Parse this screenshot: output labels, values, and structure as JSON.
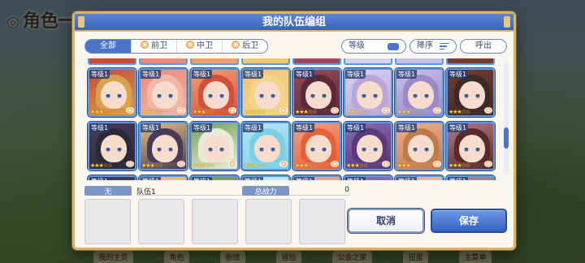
{
  "background": {
    "title": "角色一覧",
    "bottom_tabs": [
      "我的主页",
      "角色",
      "剧情",
      "冒险",
      "公会之家",
      "扭蛋",
      "主菜单"
    ]
  },
  "modal": {
    "title": "我的队伍编组",
    "filters": {
      "tabs": [
        {
          "label": "全部",
          "active": true
        },
        {
          "label": "前卫",
          "active": false
        },
        {
          "label": "中卫",
          "active": false
        },
        {
          "label": "后卫",
          "active": false
        }
      ],
      "level_label": "等级",
      "sort_label": "降序",
      "call_label": "呼出"
    },
    "characters": {
      "level_text": "等级1",
      "rows": [
        [
          {
            "hair": "#d8a14a",
            "bg": "#c44a3a",
            "stars": 3
          },
          {
            "hair": "#f1b6a8",
            "bg": "#e88b7a",
            "stars": 3
          },
          {
            "hair": "#d4503a",
            "bg": "#f0a070",
            "stars": 3
          },
          {
            "hair": "#f3d585",
            "bg": "#f5c37a",
            "stars": 3
          },
          {
            "hair": "#5a2a3a",
            "bg": "#9a4a5a",
            "stars": 3
          },
          {
            "hair": "#b9a6d8",
            "bg": "#d8d0f0",
            "stars": 3
          },
          {
            "hair": "#9a8ac8",
            "bg": "#c8c0e8",
            "stars": 3
          },
          {
            "hair": "#3a2a2a",
            "bg": "#7a3a2a",
            "stars": 3
          }
        ],
        [
          {
            "hair": "#2a2a3a",
            "bg": "#4a3a5a",
            "stars": 3
          },
          {
            "hair": "#4a3a5a",
            "bg": "#e0c080",
            "stars": 3
          },
          {
            "hair": "#e8ead8",
            "bg": "#7aa05a",
            "stars": 3
          },
          {
            "hair": "#7ad0e8",
            "bg": "#b8e6f0",
            "stars": 3
          },
          {
            "hair": "#e8603a",
            "bg": "#f0a080",
            "stars": 3
          },
          {
            "hair": "#5a3a7a",
            "bg": "#8a6ab0",
            "stars": 3
          },
          {
            "hair": "#c07a4a",
            "bg": "#f0b090",
            "stars": 3
          },
          {
            "hair": "#5a2a2a",
            "bg": "#b07a8a",
            "stars": 3
          }
        ]
      ]
    },
    "team": {
      "none_label": "无",
      "name": "队伍1",
      "power_label": "总战力",
      "power_value": "0"
    },
    "buttons": {
      "cancel": "取消",
      "save": "保存"
    }
  }
}
